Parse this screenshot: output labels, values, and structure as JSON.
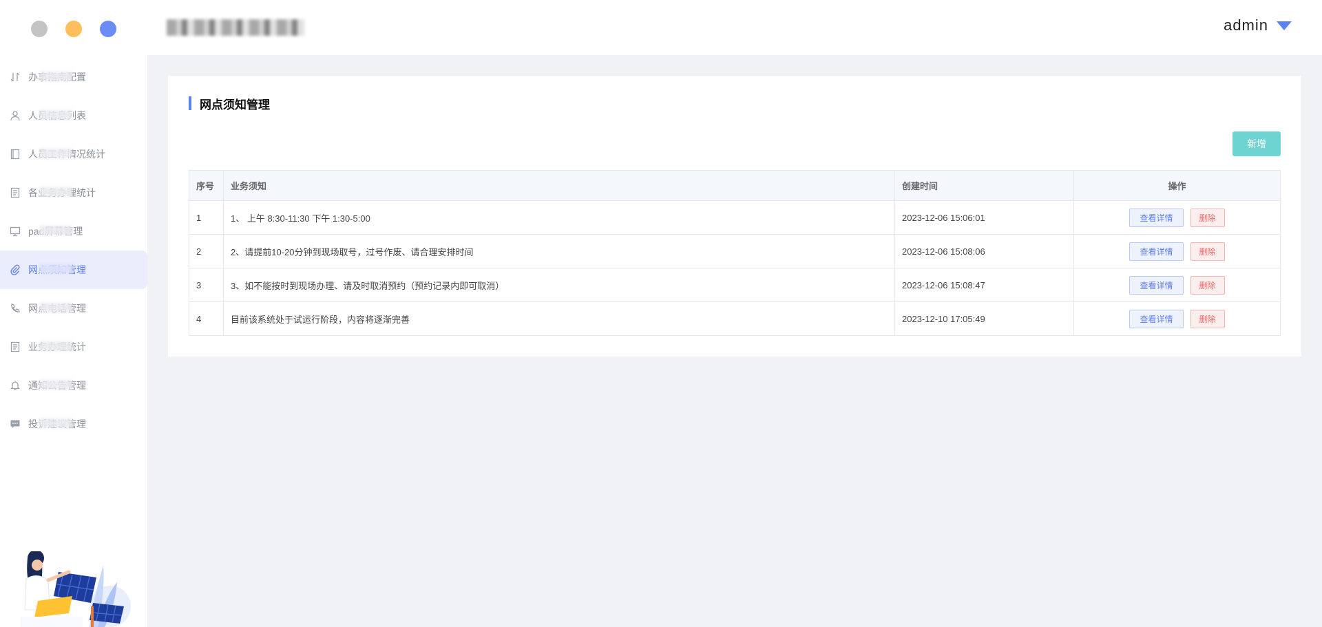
{
  "window": {
    "dot_colors": [
      "#c4c4c4",
      "#ffbe5c",
      "#6b8cf5"
    ]
  },
  "header": {
    "app_title": "",
    "user_name": "admin",
    "accent": "#5b82f0"
  },
  "sidebar": {
    "items": [
      {
        "label": "办事指南配置",
        "icon": "sort-arrows-icon",
        "active": false
      },
      {
        "label": "人员信息列表",
        "icon": "user-icon",
        "active": false
      },
      {
        "label": "人员工作情况统计",
        "icon": "notebook-icon",
        "active": false
      },
      {
        "label": "各业务办理统计",
        "icon": "document-list-icon",
        "active": false
      },
      {
        "label": "pad屏幕管理",
        "icon": "monitor-icon",
        "active": false
      },
      {
        "label": "网点须知管理",
        "icon": "paperclip-icon",
        "active": true
      },
      {
        "label": "网点电话管理",
        "icon": "phone-icon",
        "active": false
      },
      {
        "label": "业务办理统计",
        "icon": "document-list-icon",
        "active": false
      },
      {
        "label": "通知公告管理",
        "icon": "bell-icon",
        "active": false
      },
      {
        "label": "投诉建议管理",
        "icon": "chat-icon",
        "active": false
      }
    ]
  },
  "main": {
    "title": "网点须知管理",
    "add_button": "新增",
    "table": {
      "columns": [
        "序号",
        "业务须知",
        "创建时间",
        "操作"
      ],
      "rows": [
        {
          "idx": "1",
          "notice": "1、 上午 8:30-11:30 下午 1:30-5:00",
          "created": "2023-12-06 15:06:01"
        },
        {
          "idx": "2",
          "notice": "2、请提前10-20分钟到现场取号，过号作废、请合理安排时间",
          "created": "2023-12-06 15:08:06"
        },
        {
          "idx": "3",
          "notice": "3、如不能按时到现场办理、请及时取消预约（预约记录内即可取消）",
          "created": "2023-12-06 15:08:47"
        },
        {
          "idx": "4",
          "notice": "目前该系统处于试运行阶段，内容将逐渐完善",
          "created": "2023-12-10 17:05:49"
        }
      ],
      "view_label": "查看详情",
      "delete_label": "删除"
    }
  }
}
